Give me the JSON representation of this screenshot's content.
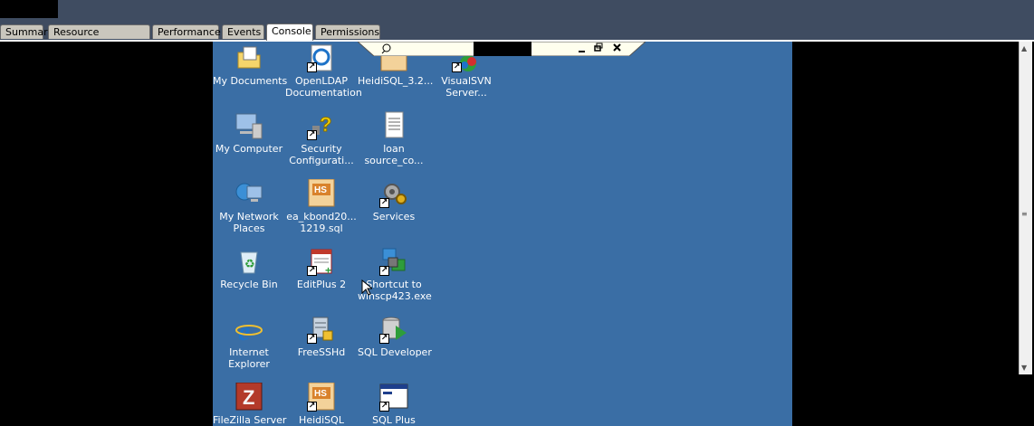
{
  "tabs": [
    {
      "label": "Summary",
      "active": false
    },
    {
      "label": "Resource Allocation",
      "active": false
    },
    {
      "label": "Performance",
      "active": false
    },
    {
      "label": "Events",
      "active": false
    },
    {
      "label": "Console",
      "active": true
    },
    {
      "label": "Permissions",
      "active": false
    }
  ],
  "colors": {
    "desktop": "#3a6ea5",
    "chrome": "#3f4c61",
    "tab_inactive": "#c9c6bd"
  },
  "remote_bar": {
    "buttons": [
      "minimize-icon",
      "restore-icon",
      "close-icon"
    ]
  },
  "desktop": {
    "icons": [
      {
        "label": "My Documents",
        "icon": "folder-documents-icon"
      },
      {
        "label": "OpenLDAP\nDocumentation",
        "icon": "ie-shortcut-icon"
      },
      {
        "label": "HeidiSQL_3.2...",
        "icon": "heidisql-icon"
      },
      {
        "label": "VisualSVN\nServer...",
        "icon": "visualsvn-icon"
      },
      {
        "label": "My Computer",
        "icon": "computer-icon"
      },
      {
        "label": "Security\nConfigurati...",
        "icon": "security-config-icon"
      },
      {
        "label": "loan\nsource_co...",
        "icon": "text-file-icon"
      },
      {
        "label": "My Network\nPlaces",
        "icon": "network-icon"
      },
      {
        "label": "ea_kbond20...\n1219.sql",
        "icon": "sql-file-icon"
      },
      {
        "label": "Services",
        "icon": "services-icon"
      },
      {
        "label": "Recycle Bin",
        "icon": "recycle-bin-icon"
      },
      {
        "label": "EditPlus 2",
        "icon": "editplus-icon"
      },
      {
        "label": "Shortcut to\nwinscp423.exe",
        "icon": "winscp-icon"
      },
      {
        "label": "Internet\nExplorer",
        "icon": "ie-icon"
      },
      {
        "label": "FreeSSHd",
        "icon": "freesshd-icon"
      },
      {
        "label": "SQL Developer",
        "icon": "sql-developer-icon"
      },
      {
        "label": "FileZilla Server",
        "icon": "filezilla-icon"
      },
      {
        "label": "HeidiSQL",
        "icon": "heidisql-icon"
      },
      {
        "label": "SQL Plus",
        "icon": "sqlplus-icon"
      }
    ]
  }
}
